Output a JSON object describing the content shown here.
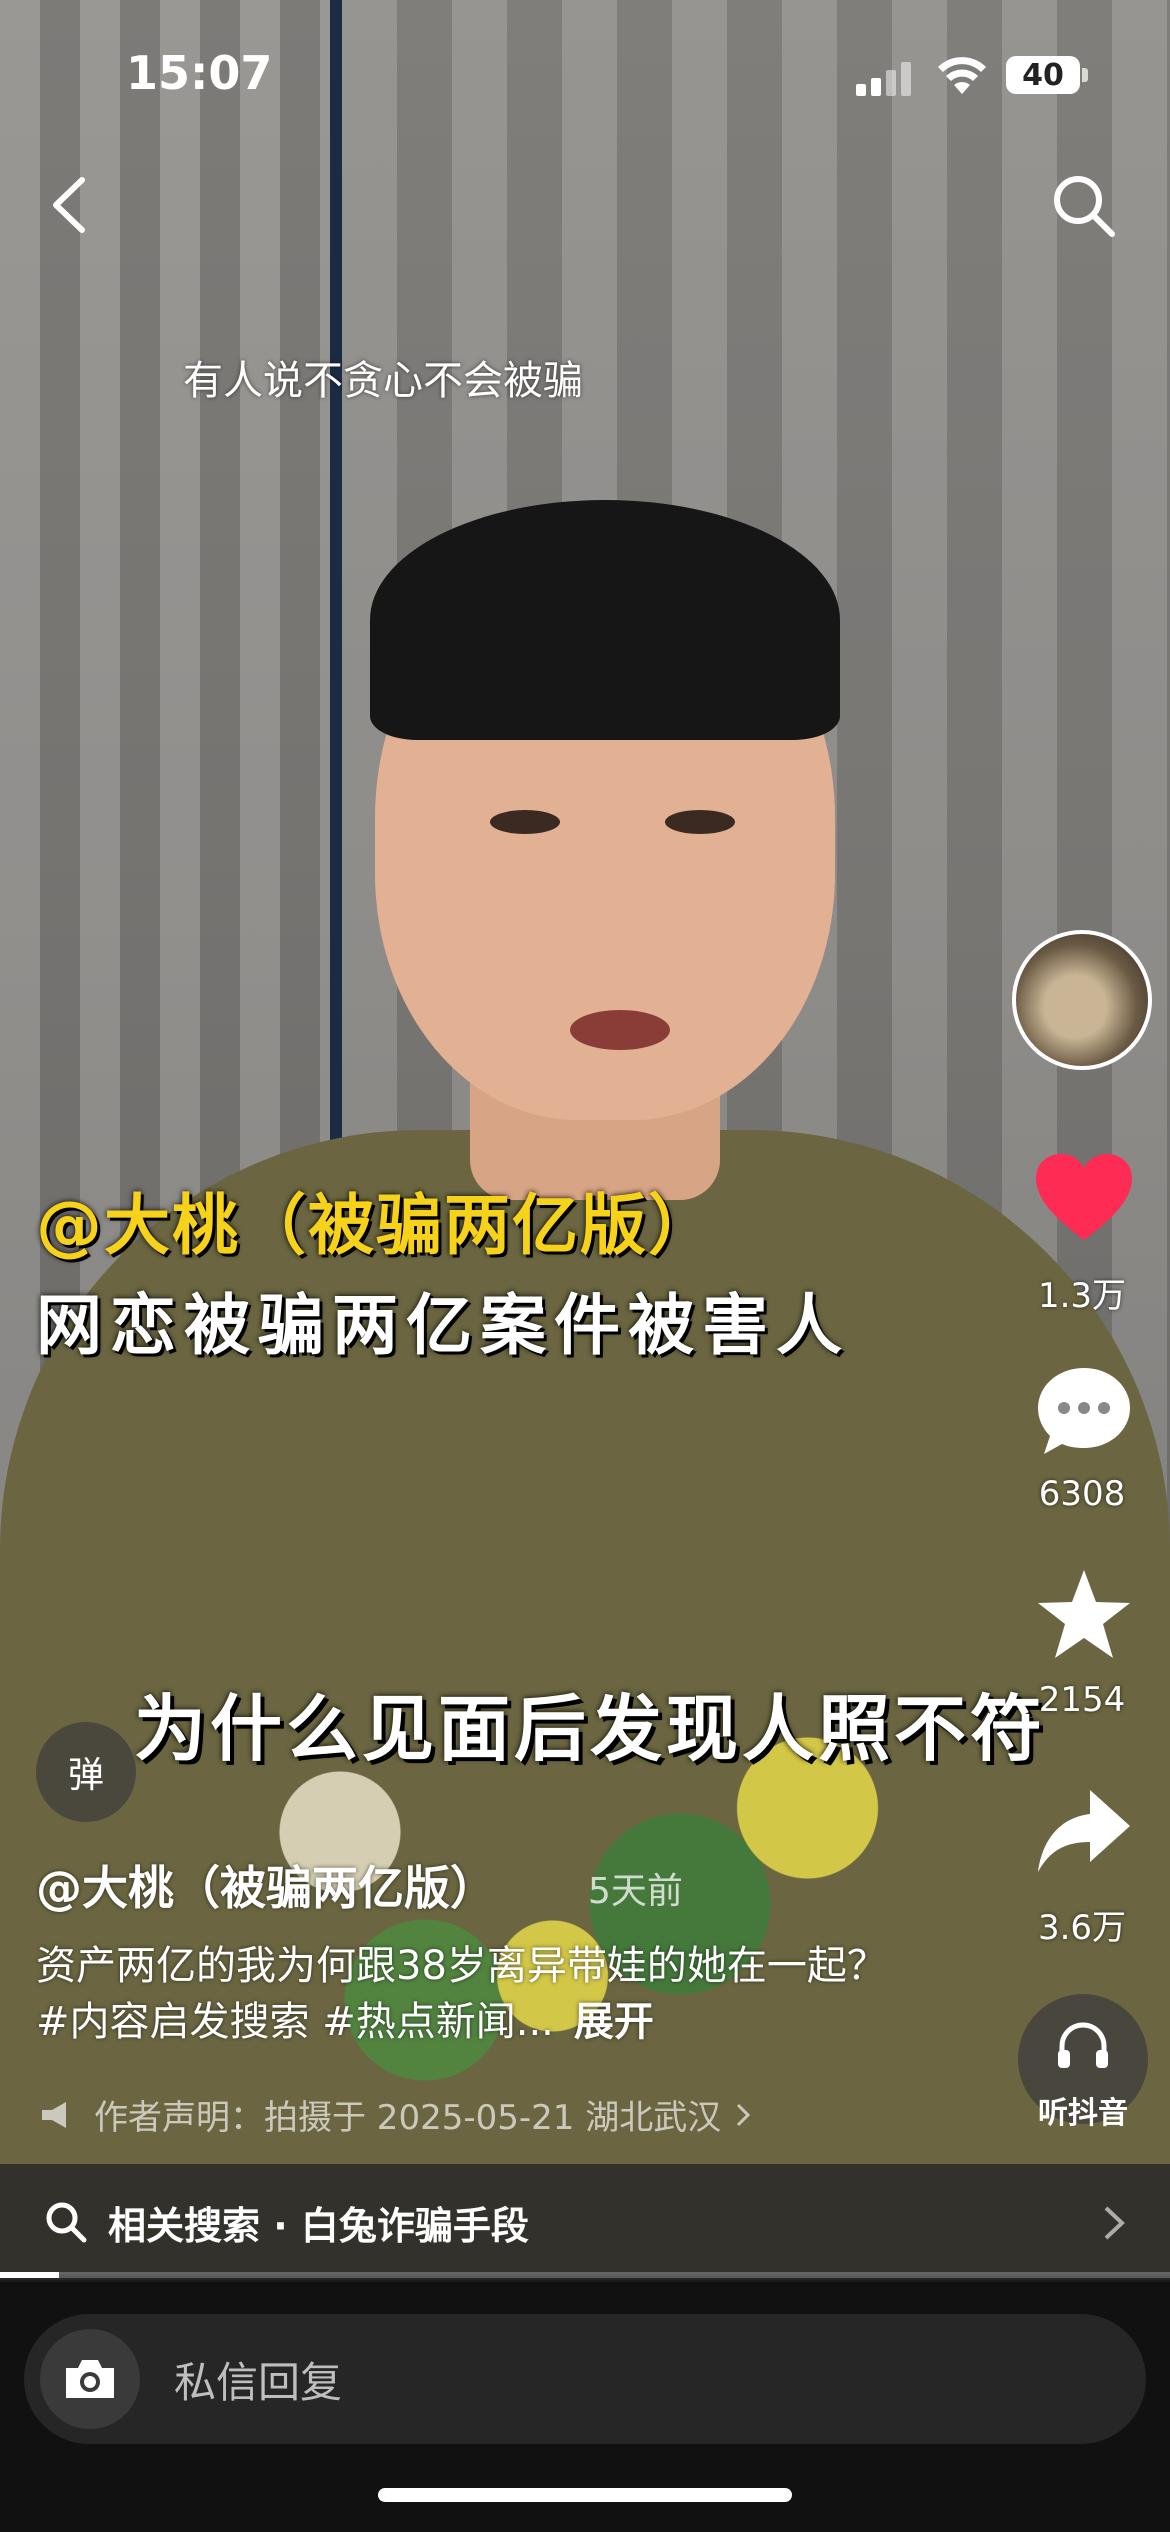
{
  "status_bar": {
    "time": "15:07",
    "battery": "40"
  },
  "video": {
    "subtitle_top": "有人说不贪心不会被骗",
    "overlay_line1": "@大桃（被骗两亿版）",
    "overlay_line2": "网恋被骗两亿案件被害人",
    "overlay_bottom": "为什么见面后发现人照不符"
  },
  "right_rail": {
    "likes": "1.3万",
    "comments": "6308",
    "favorites": "2154",
    "shares": "3.6万",
    "listen_label": "听抖音"
  },
  "caption": {
    "danmu_label": "弹",
    "author": "@大桃（被骗两亿版）",
    "time_ago": "5天前",
    "description": "资产两亿的我为何跟38岁离异带娃的她在一起？ #内容启发搜索 #热点新闻...",
    "expand": "展开",
    "declaration": "作者声明：拍摄于 2025-05-21 湖北武汉"
  },
  "related_search": {
    "text": "相关搜索 · 白兔诈骗手段"
  },
  "progress": 0.05,
  "reply": {
    "placeholder": "私信回复"
  },
  "colors": {
    "like": "#fe2c55",
    "overlay_yellow": "#f6d21a"
  },
  "icons": [
    "back-icon",
    "search-icon",
    "heart-icon",
    "comment-icon",
    "star-icon",
    "share-icon",
    "headphones-icon",
    "camera-icon",
    "megaphone-icon"
  ]
}
